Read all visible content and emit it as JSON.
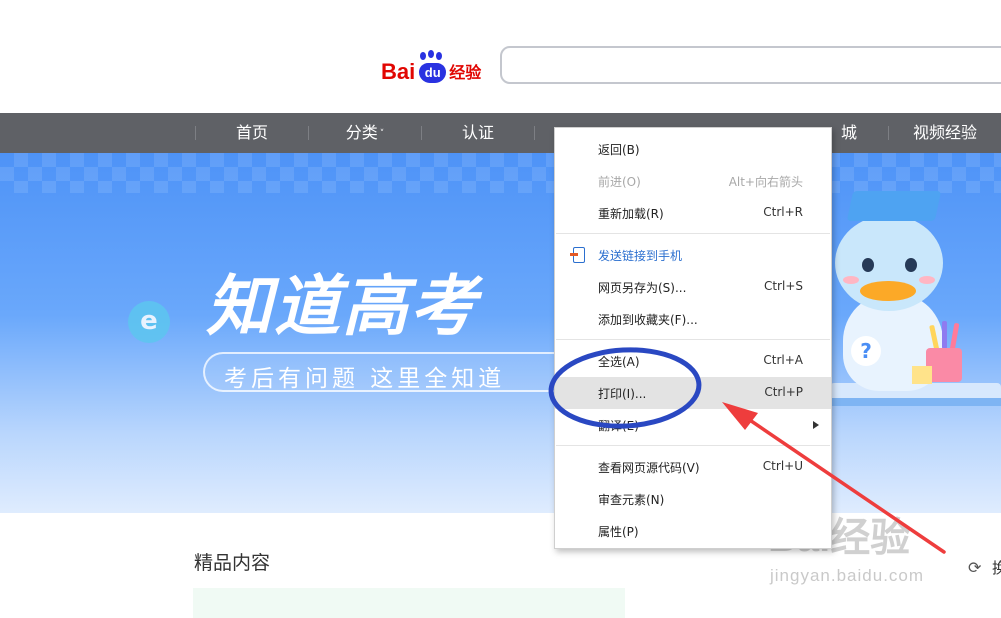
{
  "header": {
    "logo": {
      "bai": "Bai",
      "du": "du",
      "jingyan": "经验"
    },
    "search": {
      "value": "",
      "placeholder": ""
    }
  },
  "nav": {
    "items": [
      {
        "label": "首页"
      },
      {
        "label": "分类"
      },
      {
        "label": "认证"
      },
      {
        "label": "城"
      },
      {
        "label": "视频经验"
      }
    ],
    "caret": "˅"
  },
  "banner": {
    "title": "知道高考",
    "subtitle": "考后有问题  这里全知道",
    "badge": "e",
    "question_mark": "?"
  },
  "context_menu": {
    "items": [
      {
        "label": "返回(B)",
        "shortcut": ""
      },
      {
        "label": "前进(O)",
        "shortcut": "Alt+向右箭头"
      },
      {
        "label": "重新加载(R)",
        "shortcut": "Ctrl+R"
      },
      {
        "label": "发送链接到手机",
        "shortcut": ""
      },
      {
        "label": "网页另存为(S)...",
        "shortcut": "Ctrl+S"
      },
      {
        "label": "添加到收藏夹(F)...",
        "shortcut": ""
      },
      {
        "label": "全选(A)",
        "shortcut": "Ctrl+A"
      },
      {
        "label": "打印(I)...",
        "shortcut": "Ctrl+P"
      },
      {
        "label": "翻译(E)",
        "shortcut": ""
      },
      {
        "label": "查看网页源代码(V)",
        "shortcut": "Ctrl+U"
      },
      {
        "label": "审查元素(N)",
        "shortcut": ""
      },
      {
        "label": "属性(P)",
        "shortcut": ""
      }
    ]
  },
  "main": {
    "section_title": "精品内容",
    "refresh_label": "换"
  },
  "watermark": {
    "brand": "Bai经验",
    "url": "jingyan.baidu.com"
  },
  "colors": {
    "nav_bg": "#5f6166",
    "brand_red": "#e10602",
    "brand_blue": "#2932e1",
    "annotation_circle": "#2a48c2",
    "annotation_arrow": "#ee3d3d"
  }
}
